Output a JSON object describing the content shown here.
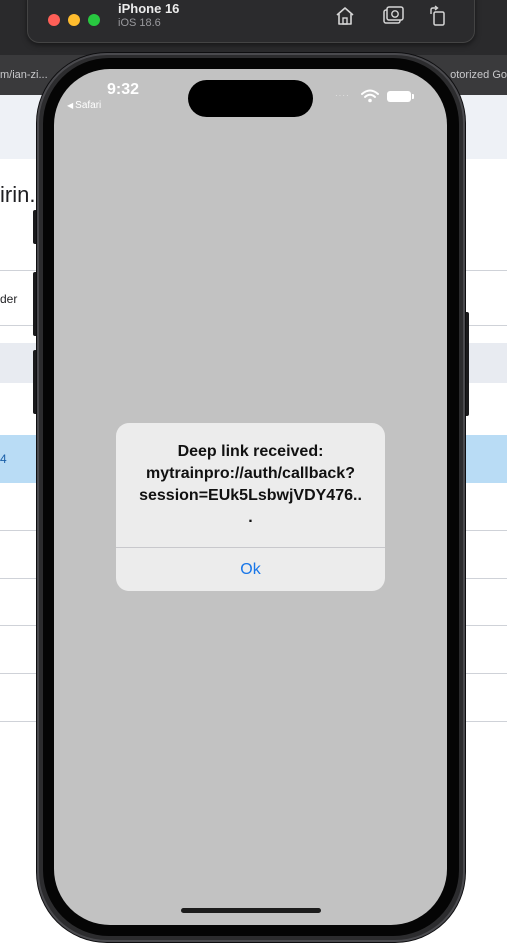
{
  "simulator": {
    "device_name": "iPhone 16",
    "os_version": "iOS 18.6",
    "toolbar_icons": [
      "home-icon",
      "screenshot-icon",
      "rotate-icon"
    ]
  },
  "background_page": {
    "url_fragment_left": "m/ian-zi...",
    "url_fragment_right": "otorized Go",
    "heading_fragment": "irin.",
    "row_fragments": [
      "der",
      "4"
    ]
  },
  "status_bar": {
    "time": "9:32",
    "back_app": "Safari",
    "signal_dots": "····"
  },
  "alert": {
    "message": "Deep link received:\nmytrainpro://auth/callback?\nsession=EUk5LsbwjVDY476..\n.",
    "ok_label": "Ok",
    "ok_color": "#1876e8"
  },
  "colors": {
    "screen_background": "#c2c2c2",
    "alert_background": "#ececec"
  }
}
